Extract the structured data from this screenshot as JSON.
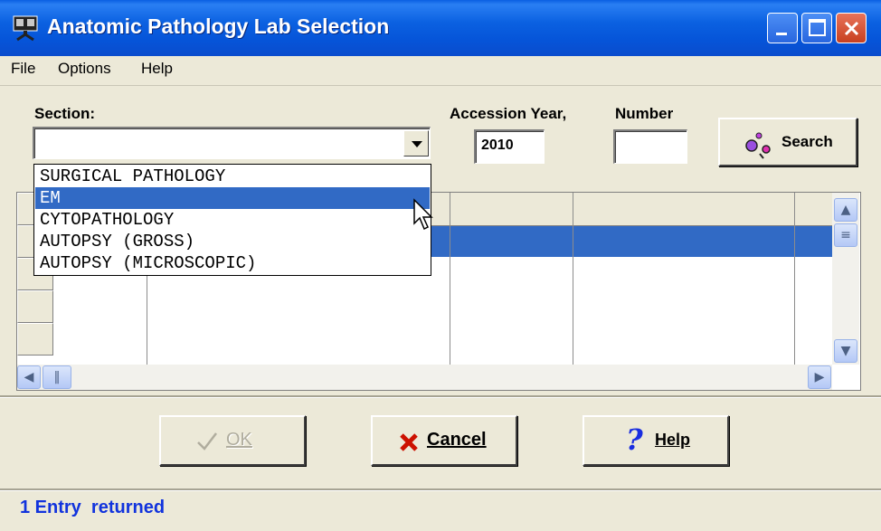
{
  "window": {
    "title": "Anatomic Pathology Lab Selection"
  },
  "menu": [
    "File",
    "Options",
    "Help"
  ],
  "form": {
    "section_label": "Section:",
    "section_value": "",
    "accession_label": "Accession Year,",
    "number_label": "Number",
    "year_value": "2010",
    "number_value": "",
    "search_label": "Search"
  },
  "dropdown": {
    "options": [
      "SURGICAL PATHOLOGY",
      "EM",
      "CYTOPATHOLOGY",
      "AUTOPSY (GROSS)",
      "AUTOPSY (MICROSCOPIC)"
    ],
    "highlighted": "EM"
  },
  "buttons": {
    "ok": "OK",
    "cancel": "Cancel",
    "help": "Help"
  },
  "status": {
    "text": "1 Entry  returned"
  },
  "colors": {
    "titlebar": "#0a5fe2",
    "selection": "#316ac5",
    "status_text": "#1133dd"
  },
  "icons": [
    "camera-app-icon",
    "minimize-icon",
    "maximize-icon",
    "close-icon",
    "dropdown-arrow-icon",
    "search-icon",
    "checkmark-icon",
    "x-icon",
    "question-icon",
    "mouse-cursor-icon"
  ]
}
